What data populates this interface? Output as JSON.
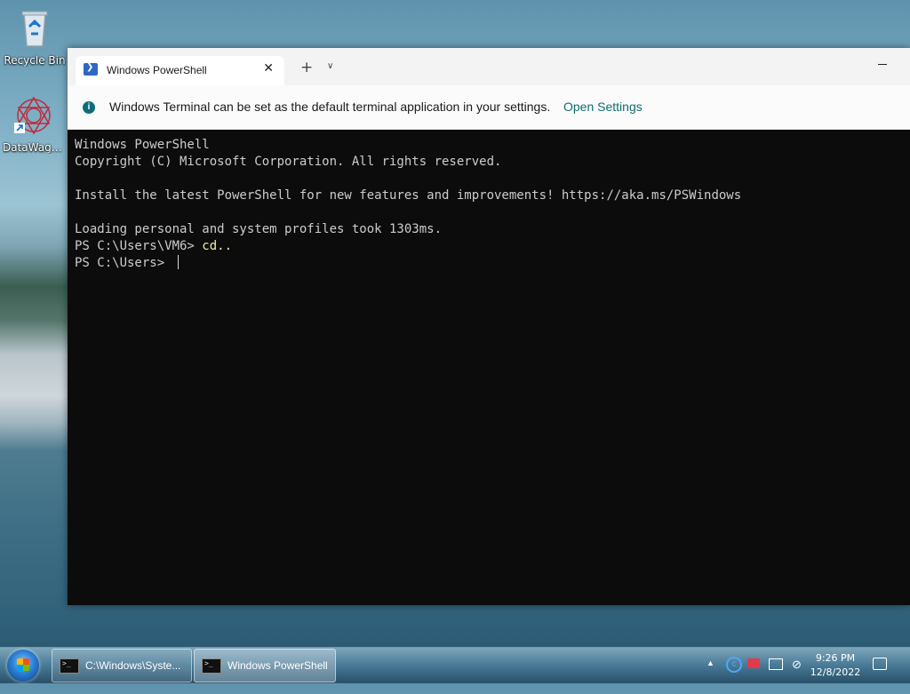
{
  "desktop": {
    "icons": [
      {
        "label": "Recycle Bin",
        "icon": "recycle-bin-icon"
      },
      {
        "label": "DataWagon...",
        "icon": "datawagon-shortcut-icon"
      }
    ]
  },
  "terminal": {
    "tab_title": "Windows PowerShell",
    "info_message": "Windows Terminal can be set as the default terminal application in your settings.",
    "info_link": "Open Settings",
    "lines": [
      {
        "text": "Windows PowerShell"
      },
      {
        "text": "Copyright (C) Microsoft Corporation. All rights reserved."
      },
      {
        "text": ""
      },
      {
        "text": "Install the latest PowerShell for new features and improvements! https://aka.ms/PSWindows"
      },
      {
        "text": ""
      },
      {
        "text": "Loading personal and system profiles took 1303ms."
      },
      {
        "prompt": "PS C:\\Users\\VM6> ",
        "command": "cd.."
      },
      {
        "prompt": "PS C:\\Users> ",
        "command": ""
      }
    ]
  },
  "taskbar": {
    "tasks": [
      {
        "label": "C:\\Windows\\Syste..."
      },
      {
        "label": "Windows PowerShell"
      }
    ],
    "time": "9:26 PM",
    "date": "12/8/2022"
  },
  "colors": {
    "console_bg": "#0c0c0c",
    "console_text": "#cccccc",
    "command_text": "#f0f0a8",
    "link": "#116b6f"
  }
}
